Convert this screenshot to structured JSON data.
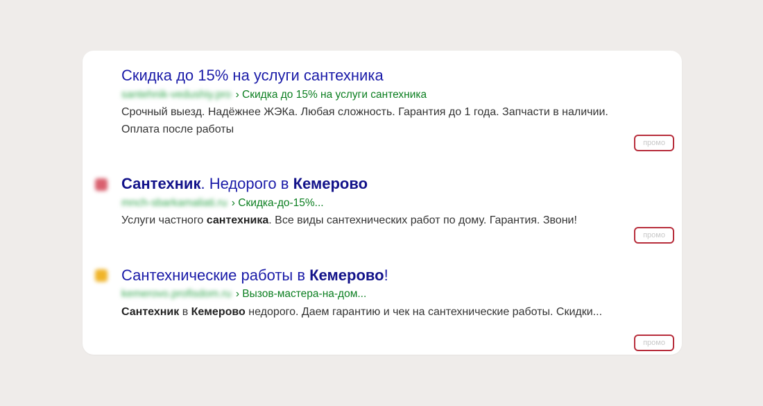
{
  "colors": {
    "background": "#efecea",
    "card": "#ffffff",
    "title": "#1a1ba8",
    "url": "#0a7e1f",
    "text": "#333333",
    "promo_border": "#b72c3a"
  },
  "ads": [
    {
      "title_parts": {
        "p1": "Скидка до 15% на услуги сантехника"
      },
      "url_path": "› Скидка до 15% на услуги сантехника",
      "desc_parts": {
        "p1": "Срочный выезд. Надёжнее ЖЭКа. Любая сложность. Гарантия до 1 года. Запчасти в наличии. Оплата после работы"
      },
      "promo_label": "промо"
    },
    {
      "favicon_color": "#d9606e",
      "title_parts": {
        "b1": "Сантехник",
        "t1": ". Недорого в ",
        "b2": "Кемерово"
      },
      "url_path": "› Скидка-до-15%...",
      "desc_parts": {
        "t1": "Услуги частного ",
        "b1": "сантехника",
        "t2": ". Все виды сантехнических работ по дому. Гарантия. Звони!"
      },
      "promo_label": "промо"
    },
    {
      "favicon_color": "#f0b429",
      "title_parts": {
        "t1": "Сантехнические работы в ",
        "b1": "Кемерово",
        "t2": "!"
      },
      "url_path": "› Вызов-мастера-на-дом...",
      "desc_parts": {
        "b1": "Сантехник",
        "t1": " в ",
        "b2": "Кемерово",
        "t2": " недорого. Даем гарантию и чек на сантехнические работы. Скидки..."
      },
      "promo_label": "промо"
    }
  ]
}
